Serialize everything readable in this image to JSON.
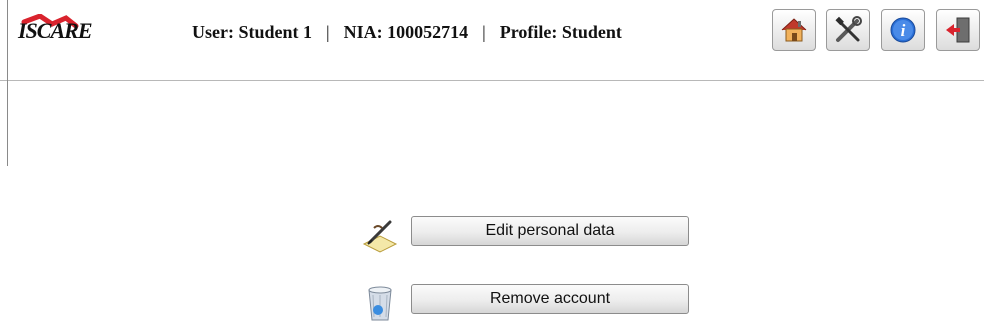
{
  "header": {
    "logo_text": "ISCARE",
    "user_label": "User: Student 1",
    "nia_label": "NIA: 100052714",
    "profile_label": "Profile: Student",
    "separator": "|"
  },
  "toolbar": {
    "icons": [
      "home-icon",
      "tools-icon",
      "info-icon",
      "logout-icon"
    ]
  },
  "actions": {
    "edit_label": "Edit personal data",
    "edit_icon": "edit-pen-icon",
    "remove_label": "Remove account",
    "remove_icon": "recycle-bin-icon"
  },
  "colors": {
    "logo_red": "#d9232d",
    "info_blue": "#2a6fd6",
    "home_orange": "#e87b1e"
  }
}
